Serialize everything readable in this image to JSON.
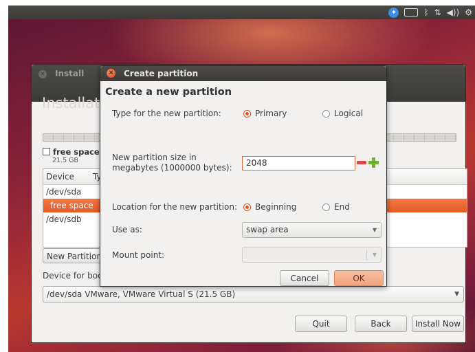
{
  "topbar": {
    "icons": [
      "accessibility-icon",
      "keyboard-icon",
      "bluetooth-icon",
      "network-icon",
      "volume-icon",
      "settings-gear-icon"
    ],
    "accessibility_glyph": "✦",
    "keyboard_glyph": "▭",
    "bluetooth_glyph": "ᛒ",
    "network_glyph": "⇅",
    "volume_glyph": "◀))",
    "gear_glyph": "⚙"
  },
  "installer": {
    "close_glyph": "×",
    "title": "Install",
    "heading": "Installatio",
    "legend": {
      "name": "free space",
      "size": "21.5 GB"
    },
    "table": {
      "headers": [
        "Device",
        "Typ"
      ],
      "rows": [
        "/dev/sda",
        "free space",
        "/dev/sdb"
      ],
      "selected_index": 1
    },
    "new_partition_table_button": "New Partition Ta",
    "boot_label": "Device for boot l",
    "boot_device": "/dev/sda  VMware, VMware Virtual S (21.5 GB)",
    "buttons": {
      "quit": "Quit",
      "back": "Back",
      "install_now": "Install Now"
    }
  },
  "dialog": {
    "title": "Create partition",
    "close_glyph": "×",
    "heading": "Create a new partition",
    "type_label": "Type for the new partition:",
    "type_options": [
      "Primary",
      "Logical"
    ],
    "type_selected": "Primary",
    "size_label_line1": "New partition size in",
    "size_label_line2": "megabytes (1000000 bytes):",
    "size_value": "2048",
    "location_label": "Location for the new partition:",
    "location_options": [
      "Beginning",
      "End"
    ],
    "location_selected": "Beginning",
    "use_as_label": "Use as:",
    "use_as_value": "swap area",
    "mount_label": "Mount point:",
    "mount_value": "",
    "cancel_label": "Cancel",
    "ok_label": "OK",
    "colors": {
      "accent": "#e95420",
      "ok_button": "#f6ad8a",
      "minus": "#dd4a4a",
      "plus": "#6fb22e"
    }
  }
}
